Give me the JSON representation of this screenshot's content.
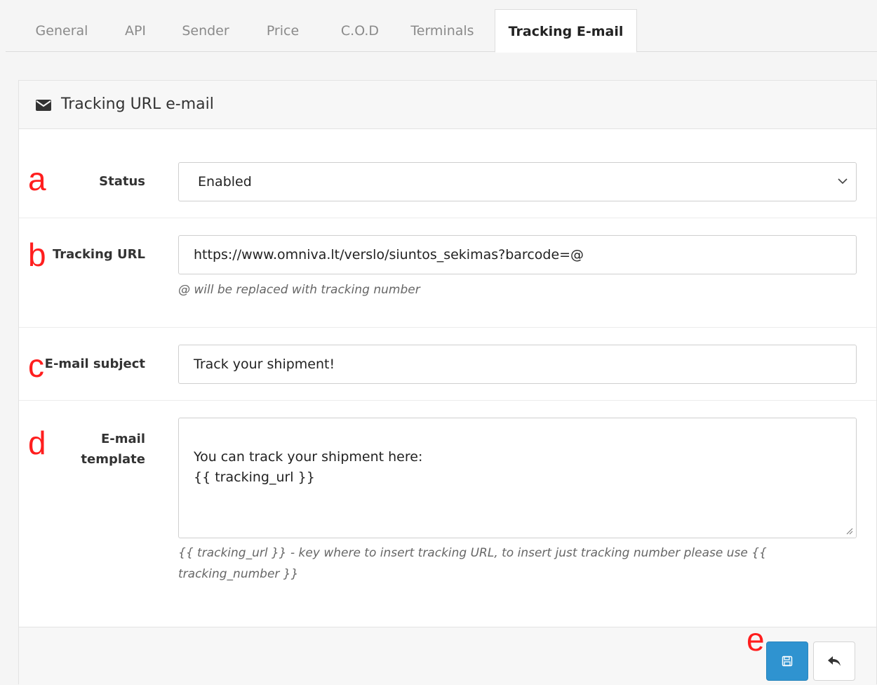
{
  "tabs": [
    {
      "label": "General"
    },
    {
      "label": "API"
    },
    {
      "label": "Sender"
    },
    {
      "label": "Price"
    },
    {
      "label": "C.O.D"
    },
    {
      "label": "Terminals"
    },
    {
      "label": "Tracking E-mail",
      "active": true
    }
  ],
  "panel": {
    "title": "Tracking URL e-mail",
    "icon": "envelope-icon"
  },
  "form": {
    "status": {
      "label": "Status",
      "value": "Enabled"
    },
    "tracking_url": {
      "label": "Tracking URL",
      "value": "https://www.omniva.lt/verslo/siuntos_sekimas?barcode=@",
      "help": "@ will be replaced with tracking number"
    },
    "subject": {
      "label": "E-mail subject",
      "value": "Track your shipment!"
    },
    "template": {
      "label_line1": "E-mail",
      "label_line2": "template",
      "value": "You can track your shipment here:\n{{ tracking_url }}",
      "help_line1": "{{ tracking_url }} - key where to insert tracking URL, to insert just tracking number please use {{",
      "help_line2": "tracking_number }}"
    }
  },
  "buttons": {
    "save_icon": "save-icon",
    "back_icon": "back-icon"
  },
  "annotations": {
    "a": "a",
    "b": "b",
    "c": "c",
    "d": "d",
    "e": "e",
    "color": "#ff1e1e"
  },
  "colors": {
    "primary": "#2f93d0",
    "background": "#f5f5f5"
  }
}
